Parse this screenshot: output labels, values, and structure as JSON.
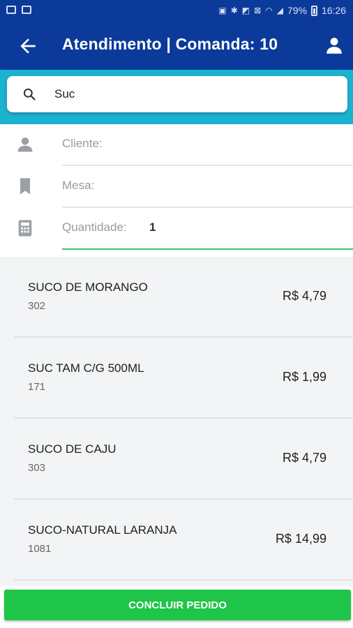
{
  "status_bar": {
    "battery_text": "79%",
    "time": "16:26"
  },
  "app_bar": {
    "title": "Atendimento | Comanda: 10",
    "back_icon": "arrow-left-icon",
    "user_icon": "user-icon"
  },
  "search": {
    "icon": "search-icon",
    "value": "Suc"
  },
  "form": {
    "client": {
      "label": "Cliente:",
      "value": "",
      "icon": "person-icon"
    },
    "table": {
      "label": "Mesa:",
      "value": "",
      "icon": "bookmark-icon"
    },
    "quantity": {
      "label": "Quantidade:",
      "value": "1",
      "icon": "calculator-icon"
    }
  },
  "products": [
    {
      "name": "SUCO DE MORANGO",
      "code": "302",
      "price": "R$ 4,79"
    },
    {
      "name": "SUC TAM C/G 500ML",
      "code": "171",
      "price": "R$ 1,99"
    },
    {
      "name": "SUCO DE CAJU",
      "code": "303",
      "price": "R$ 4,79"
    },
    {
      "name": "SUCO-NATURAL LARANJA",
      "code": "1081",
      "price": "R$ 14,99"
    }
  ],
  "footer": {
    "conclude_label": "CONCLUIR PEDIDO"
  },
  "colors": {
    "app_bar": "#0b3a9a",
    "search_band": "#1bb1d1",
    "primary_button": "#1ec548",
    "active_underline": "#43c463"
  }
}
